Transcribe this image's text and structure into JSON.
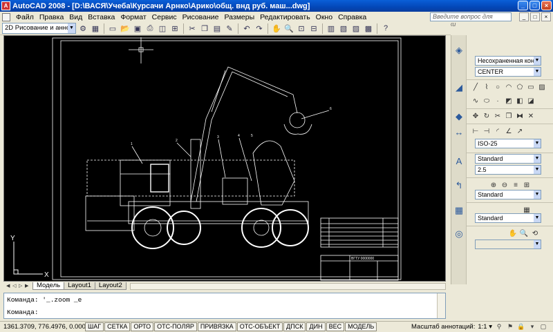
{
  "window": {
    "title": "AutoCAD 2008 - [D:\\ВАСЯ\\Учеба\\Курсачи Арнко\\Арико\\общ. внд руб. маш...dwg]",
    "app_icon": "A",
    "buttons": [
      "_",
      "□",
      "×"
    ]
  },
  "menu": {
    "items": [
      "Файл",
      "Правка",
      "Вид",
      "Вставка",
      "Формат",
      "Сервис",
      "Рисование",
      "Размеры",
      "Редактировать",
      "Окно",
      "Справка"
    ],
    "doc_buttons": [
      "_",
      "□",
      "×"
    ],
    "help_placeholder": "Введите вопрос для справки"
  },
  "toolbar": {
    "workspace": "2D Рисование и аннотации",
    "buttons": [
      "workspace-settings-icon",
      "new-icon",
      "open-icon",
      "save-icon",
      "plot-icon",
      "preview-icon",
      "publish-icon",
      "cut-icon",
      "copy-icon",
      "paste-icon",
      "match-icon",
      "undo-icon",
      "redo-icon",
      "pan-icon",
      "zoom-icon",
      "properties-icon",
      "designcenter-icon",
      "toolpalette-icon",
      "calculator-icon",
      "help-icon"
    ]
  },
  "drawing": {
    "ucs_x": "X",
    "ucs_y": "Y",
    "callouts": [
      "1",
      "2",
      "3",
      "4",
      "5",
      "6"
    ],
    "stamp_title": "ВГТУ 0000000"
  },
  "layout_tabs": [
    "Модель",
    "Layout1",
    "Layout2"
  ],
  "panel": {
    "layer": "Несохраненная конфигура",
    "linetype": "CENTER",
    "dimstyle": "ISO-25",
    "textstyle": "Standard",
    "textheight": "2.5",
    "mleaderstyle": "Standard",
    "tablestyle": "Standard"
  },
  "command": {
    "history": "Команда: '_.zoom _e",
    "prompt": "Команда:"
  },
  "status": {
    "coords": "1361.3709, 776.4976, 0.0000",
    "toggles": [
      "ШАГ",
      "СЕТКА",
      "ОРТО",
      "ОТС-ПОЛЯР",
      "ПРИВЯЗКА",
      "ОТС-ОБЪЕКТ",
      "ДПСК",
      "ДИН",
      "ВЕС",
      "МОДЕЛЬ"
    ],
    "anno_label": "Масштаб аннотаций:",
    "anno_value": "1:1 ▾"
  },
  "colors": {
    "title_bar": "#0347b8",
    "canvas": "#000000",
    "chrome": "#ece9d8"
  }
}
